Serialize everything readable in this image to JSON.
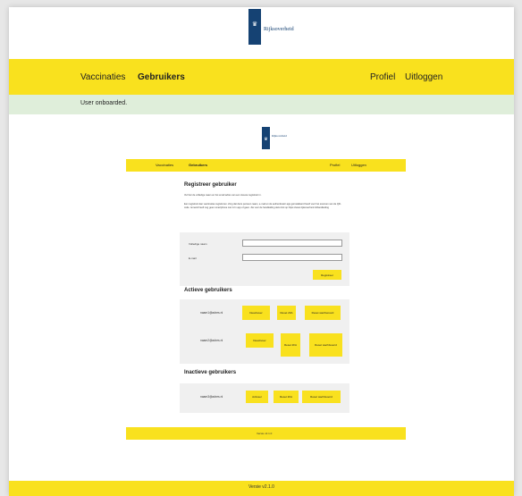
{
  "header": {
    "brand": "Rijksoverheid",
    "emblem_icon": "crown-shield-icon"
  },
  "nav": {
    "vaccinaties": "Vaccinaties",
    "gebruikers": "Gebruikers",
    "profiel": "Profiel",
    "uitloggen": "Uitloggen"
  },
  "alert": {
    "message": "User onboarded."
  },
  "mini": {
    "brand": "Rijksoverheid",
    "nav": {
      "vaccinaties": "Vaccinaties",
      "gebruikers": "Gebruikers",
      "profiel": "Profiel",
      "uitloggen": "Uitloggen"
    },
    "register": {
      "title": "Registreer gebruiker",
      "intro": "Vul hier de volledige naam en het email adres van een nieuwe registrant in.",
      "description": "Een registrant kan vaccinaties registreren. Zorg dat deze persoon naam, e-mail en de authenticator app geïnstalleerd heeft voor het scannen van de QR-code. Iemand heeft nog geen smartphone met zo'n app of geen. Zie voor de handleiding deze link op https://www.rijksoverheid.nl/handleiding",
      "fullname_label": "Volledige naam",
      "email_label": "E-mail",
      "fullname_value": "",
      "email_value": "",
      "submit_label": "Registreer"
    },
    "active": {
      "title": "Actieve gebruikers",
      "users": [
        {
          "email": "naam1@adres.nl",
          "deactivate": "Deactiveer",
          "reset2fa": "Reset 2FA",
          "resetpw": "Reset wachtwoord"
        },
        {
          "email": "naam2@adres.nl",
          "deactivate": "Deactiveer",
          "reset2fa": "Reset 2FA",
          "resetpw": "Reset wachtwoord"
        }
      ]
    },
    "inactive": {
      "title": "Inactieve gebruikers",
      "users": [
        {
          "email": "naam3@adres.nl",
          "activate": "Activeer",
          "reset2fa": "Reset 2FA",
          "resetpw": "Reset wachtwoord"
        }
      ]
    },
    "footer": "Versie v2.1.0"
  },
  "footer": {
    "version": "Versie v2.1.0"
  },
  "colors": {
    "accent": "#f9e11e",
    "brand_blue": "#154273",
    "alert_bg": "#dfeeda",
    "panel_bg": "#f0f0f0"
  }
}
